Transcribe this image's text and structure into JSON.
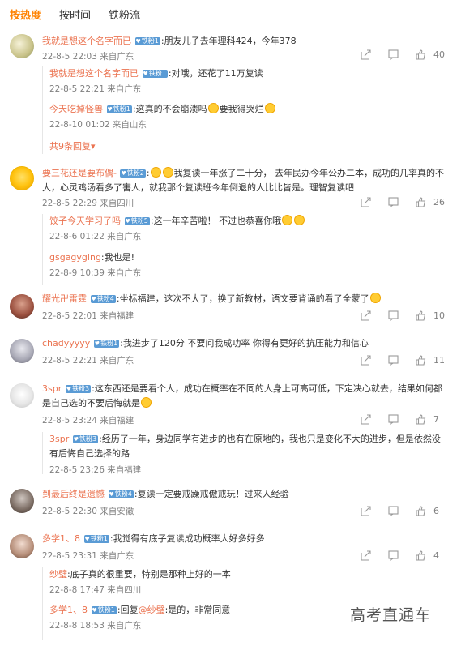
{
  "tabs": [
    {
      "label": "按热度"
    },
    {
      "label": "按时间"
    },
    {
      "label": "铁粉流"
    }
  ],
  "watermark": "高考直通车",
  "comments": [
    {
      "user": "我就是想这个名字而已",
      "badge": "铁粉1",
      "text": ":朋友儿子去年理科424，今年378",
      "meta": "22-8-5 22:03 来自广东",
      "likes": "40",
      "replies": [
        {
          "user": "我就是想这个名字而已",
          "badge": "铁粉1",
          "text": ":对哦，还花了11万复读",
          "meta": "22-8-5 22:21 来自广东"
        },
        {
          "user": "今天吃掉怪兽",
          "badge": "铁粉1",
          "text_a": ":这真的不会崩溃吗",
          "text_b": "要我得哭烂",
          "meta": "22-8-10 01:02 来自山东"
        }
      ],
      "more": "共9条回复"
    },
    {
      "user": "要三花还是要布偶-",
      "badge": "铁粉2",
      "text_a": ":",
      "text_b": "我复读一年涨了二十分， 去年民办今年公办二本，成功的几率真的不大，心灵鸡汤看多了害人，就我那个复读班今年倒退的人比比皆是。理智复读吧",
      "meta": "22-8-5 22:29 来自四川",
      "likes": "26",
      "replies": [
        {
          "user": "饺子今天学习了吗",
          "badge": "铁粉5",
          "text": ":这一年辛苦啦！ 不过也恭喜你哦",
          "meta": "22-8-6 01:22 来自广东"
        },
        {
          "user": "gsgagyging",
          "text": ":我也是!",
          "meta": "22-8-9 10:39 来自广东"
        }
      ]
    },
    {
      "user": "耀光卍雷霆",
      "badge": "铁粉4",
      "text": ":坐标福建，这次不大了，换了新教材，语文要背诵的看了全蒙了",
      "meta": "22-8-5 22:01 来自福建",
      "likes": "10"
    },
    {
      "user": "chadyyyyy",
      "badge": "铁粉1",
      "text": ":我进步了120分 不要问我成功率 你得有更好的抗压能力和信心",
      "meta": "22-8-5 22:21 来自广东",
      "likes": "11"
    },
    {
      "user": "3spr",
      "badge": "铁粉3",
      "text": ":这东西还是要看个人，成功在概率在不同的人身上可高可低，下定决心就去，结果如何都是自己选的不要后悔就是",
      "meta": "22-8-5 23:24 来自福建",
      "likes": "7",
      "replies": [
        {
          "user": "3spr",
          "badge": "铁粉3",
          "text": ":经历了一年，身边同学有进步的也有在原地的，我也只是变化不大的进步，但是依然没有后悔自己选择的路",
          "meta": "22-8-5 23:26 来自福建"
        }
      ]
    },
    {
      "user": "到最后终是遗憾",
      "badge": "铁粉4",
      "text": ":复读一定要戒躁戒傲戒玩！过来人经验",
      "meta": "22-8-5 22:30 来自安徽",
      "likes": "6"
    },
    {
      "user": "多学1、8",
      "badge": "铁粉1",
      "text": ":我觉得有底子复读成功概率大好多好多",
      "meta": "22-8-5 23:31 来自广东",
      "likes": "4",
      "replies": [
        {
          "user": "纱璧",
          "text": ":底子真的很重要，特别是那种上好的一本",
          "meta": "22-8-8 17:47 来自四川"
        },
        {
          "user": "多学1、8",
          "badge": "铁粉1",
          "text_a": ":回复",
          "mention": "@纱璧",
          "text_b": ":是的，非常同意",
          "meta": "22-8-8 18:53 来自广东"
        }
      ]
    }
  ]
}
